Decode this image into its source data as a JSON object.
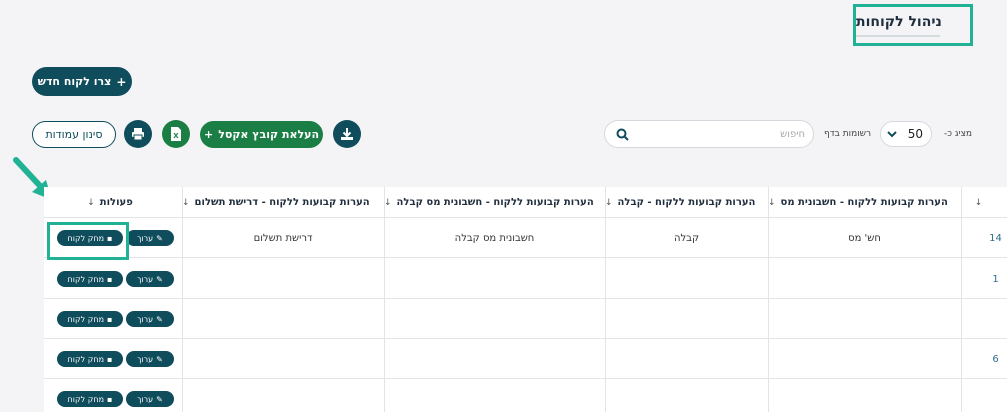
{
  "page": {
    "title": "ניהול לקוחות"
  },
  "toolbar": {
    "create_label": "צרו לקוח חדש",
    "upload_excel_label": "העלאת קובץ אקסל",
    "filter_columns_label": "סינון עמודות",
    "per_page_prefix": "מציג כ-",
    "per_page_value": "50",
    "per_page_suffix": "רשומות בדף",
    "search_placeholder": "חיפוש"
  },
  "table": {
    "columns": [
      "הערות קבועות ללקוח - חשבונית מס",
      "הערות קבועות ללקוח - קבלה",
      "הערות קבועות ללקוח - חשבונית מס קבלה",
      "הערות קבועות ללקוח - דרישת תשלום",
      "פעולות"
    ],
    "edge_cells": [
      "14",
      "1",
      "",
      "6",
      ""
    ],
    "rows": [
      [
        "חש' מס",
        "קבלה",
        "חשבונית מס קבלה",
        "דרישת תשלום"
      ],
      [
        "",
        "",
        "",
        ""
      ],
      [
        "",
        "",
        "",
        ""
      ],
      [
        "",
        "",
        "",
        ""
      ],
      [
        "",
        "",
        "",
        ""
      ]
    ],
    "edit_label": "ערוך",
    "delete_label": "מחק לקוח"
  },
  "colors": {
    "accent": "#21b295",
    "primary": "#0f4c5c",
    "excel": "#1b7f45"
  }
}
